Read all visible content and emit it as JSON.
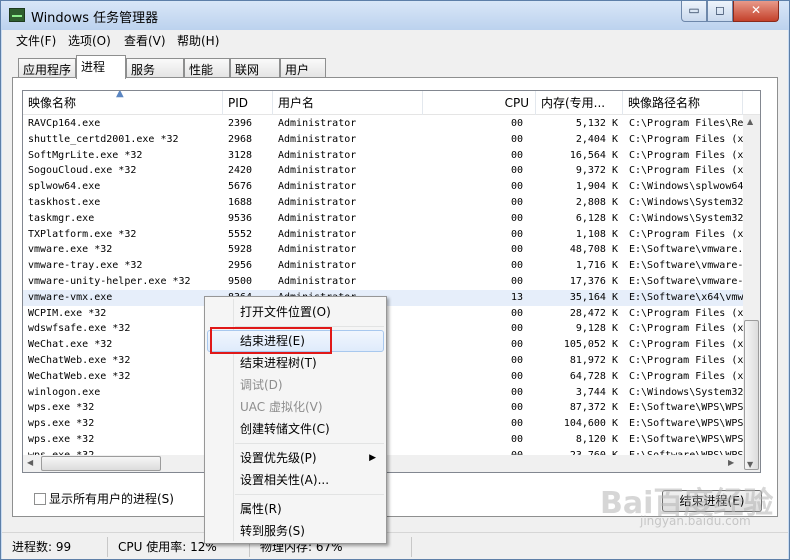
{
  "window": {
    "title": "Windows 任务管理器",
    "buttons": {
      "minimize": "▭",
      "maximize": "◻",
      "close": "✕"
    }
  },
  "menu": [
    "文件(F)",
    "选项(O)",
    "查看(V)",
    "帮助(H)"
  ],
  "tabs": [
    "应用程序",
    "进程",
    "服务",
    "性能",
    "联网",
    "用户"
  ],
  "active_tab": "进程",
  "table": {
    "headers": [
      "映像名称",
      "PID",
      "用户名",
      "CPU",
      "内存(专用...",
      "映像路径名称"
    ],
    "rows": [
      [
        "RAVCp164.exe",
        "2396",
        "Administrator",
        "00",
        "5,132 K",
        "C:\\Program Files\\Re"
      ],
      [
        "shuttle_certd2001.exe *32",
        "2968",
        "Administrator",
        "00",
        "2,404 K",
        "C:\\Program Files (x"
      ],
      [
        "SoftMgrLite.exe *32",
        "3128",
        "Administrator",
        "00",
        "16,564 K",
        "C:\\Program Files (x"
      ],
      [
        "SogouCloud.exe *32",
        "2420",
        "Administrator",
        "00",
        "9,372 K",
        "C:\\Program Files (x"
      ],
      [
        "splwow64.exe",
        "5676",
        "Administrator",
        "00",
        "1,904 K",
        "C:\\Windows\\splwow64"
      ],
      [
        "taskhost.exe",
        "1688",
        "Administrator",
        "00",
        "2,808 K",
        "C:\\Windows\\System32"
      ],
      [
        "taskmgr.exe",
        "9536",
        "Administrator",
        "00",
        "6,128 K",
        "C:\\Windows\\System32"
      ],
      [
        "TXPlatform.exe *32",
        "5552",
        "Administrator",
        "00",
        "1,108 K",
        "C:\\Program Files (x"
      ],
      [
        "vmware.exe *32",
        "5928",
        "Administrator",
        "00",
        "48,708 K",
        "E:\\Software\\vmware."
      ],
      [
        "vmware-tray.exe *32",
        "2956",
        "Administrator",
        "00",
        "1,716 K",
        "E:\\Software\\vmware-"
      ],
      [
        "vmware-unity-helper.exe *32",
        "9500",
        "Administrator",
        "00",
        "17,376 K",
        "E:\\Software\\vmware-"
      ],
      [
        "vmware-vmx.exe",
        "8364",
        "Administrator",
        "13",
        "35,164 K",
        "E:\\Software\\x64\\vmw"
      ],
      [
        "WCPIM.exe *32",
        "",
        "",
        "00",
        "28,472 K",
        "C:\\Program Files (x"
      ],
      [
        "wdswfsafe.exe *32",
        "",
        "",
        "00",
        "9,128 K",
        "C:\\Program Files (x"
      ],
      [
        "WeChat.exe *32",
        "",
        "",
        "00",
        "105,052 K",
        "C:\\Program Files (x"
      ],
      [
        "WeChatWeb.exe *32",
        "",
        "",
        "00",
        "81,972 K",
        "C:\\Program Files (x"
      ],
      [
        "WeChatWeb.exe *32",
        "",
        "",
        "00",
        "64,728 K",
        "C:\\Program Files (x"
      ],
      [
        "winlogon.exe",
        "",
        "",
        "00",
        "3,744 K",
        "C:\\Windows\\System32"
      ],
      [
        "wps.exe *32",
        "",
        "",
        "00",
        "87,372 K",
        "E:\\Software\\WPS\\WPS"
      ],
      [
        "wps.exe *32",
        "",
        "",
        "00",
        "104,600 K",
        "E:\\Software\\WPS\\WPS"
      ],
      [
        "wps.exe *32",
        "",
        "",
        "00",
        "8,120 K",
        "E:\\Software\\WPS\\WPS"
      ],
      [
        "wps.exe *32",
        "",
        "",
        "00",
        "23,760 K",
        "E:\\Software\\WPS\\WPS"
      ]
    ]
  },
  "show_all_users_label": "显示所有用户的进程(S)",
  "end_process_button": "结束进程(E)",
  "status": {
    "processes": "进程数: 99",
    "cpu": "CPU 使用率: 12%",
    "memory": "物理内存: 67%"
  },
  "context_menu": {
    "items": [
      {
        "label": "打开文件位置(O)",
        "disabled": false
      },
      {
        "label": "结束进程(E)",
        "disabled": false,
        "highlighted": true
      },
      {
        "label": "结束进程树(T)",
        "disabled": false
      },
      {
        "label": "调试(D)",
        "disabled": true
      },
      {
        "label": "UAC 虚拟化(V)",
        "disabled": true
      },
      {
        "label": "创建转储文件(C)",
        "disabled": false
      },
      {
        "label": "设置优先级(P)",
        "disabled": false,
        "submenu": true
      },
      {
        "label": "设置相关性(A)...",
        "disabled": false
      },
      {
        "label": "属性(R)",
        "disabled": false
      },
      {
        "label": "转到服务(S)",
        "disabled": false
      }
    ]
  },
  "watermark": {
    "brand": "Bai百度经验",
    "url": "jingyan.baidu.com"
  },
  "colors": {
    "highlight_box": "#e01818",
    "selected_row": "#e6eefa",
    "titlebar": "#c9dcf2"
  }
}
